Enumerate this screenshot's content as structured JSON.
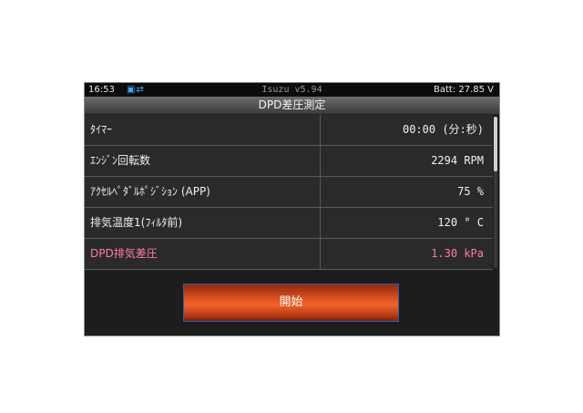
{
  "status": {
    "time": "16:53",
    "title": "Isuzu v5.94",
    "battery": "Batt: 27.85 V"
  },
  "screen": {
    "title": "DPD差圧測定"
  },
  "rows": [
    {
      "name": "ﾀｲﾏｰ",
      "value": "00:00 (分:秒)"
    },
    {
      "name": "ｴﾝｼﾞﾝ回転数",
      "value": "2294 RPM"
    },
    {
      "name": "ｱｸｾﾙﾍﾟﾀﾞﾙﾎﾟｼﾞｼｮﾝ (APP)",
      "value": "75 %"
    },
    {
      "name": "排気温度1(ﾌｨﾙﾀ前)",
      "value": "120 ° C"
    },
    {
      "name": "DPD排気差圧",
      "value": "1.30 kPa"
    }
  ],
  "actions": {
    "start_label": "開始"
  },
  "icons": {
    "status_icon": "connection-icon"
  },
  "colors": {
    "highlight": "#ff7aa8",
    "accent": "#f0642b"
  }
}
